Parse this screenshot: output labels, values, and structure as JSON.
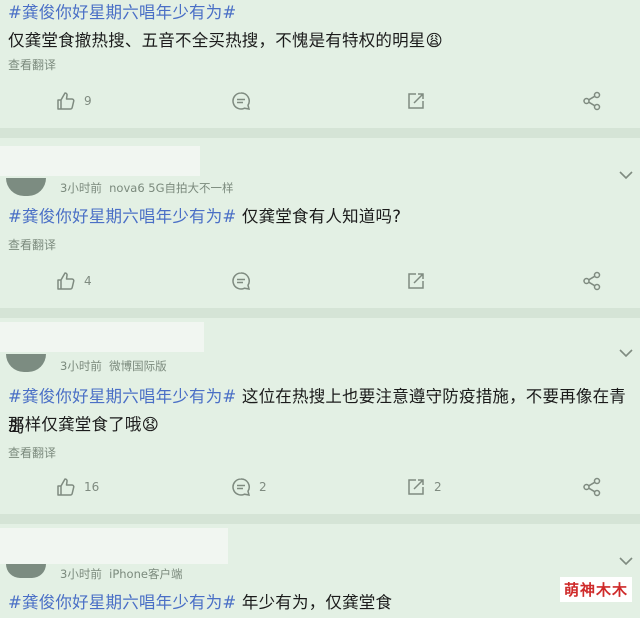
{
  "posts": [
    {
      "hashtag": "#龚俊你好星期六唱年少有为#",
      "text": "仅龚堂食撤热搜、五音不全买热搜，不愧是有特权的明星😩",
      "translate": "查看翻译",
      "likes": "9",
      "comments": "",
      "reposts": ""
    },
    {
      "time": "3小时前",
      "source": "nova6 5G自拍大不一样",
      "hashtag": "#龚俊你好星期六唱年少有为#",
      "text": " 仅龚堂食有人知道吗?",
      "translate": "查看翻译",
      "likes": "4",
      "comments": "",
      "reposts": ""
    },
    {
      "time": "3小时前",
      "source": "微博国际版",
      "hashtag": "#龚俊你好星期六唱年少有为#",
      "text": " 这位在热搜上也要注意遵守防疫措施，不要再像在青岛",
      "text2": "那样仅龚堂食了哦😧",
      "translate": "查看翻译",
      "likes": "16",
      "comments": "2",
      "reposts": "2"
    },
    {
      "time": "3小时前",
      "source": "iPhone客户端",
      "hashtag": "#龚俊你好星期六唱年少有为#",
      "text": " 年少有为，仅龚堂食"
    }
  ],
  "watermark": "萌神木木",
  "colors": {
    "hashtag": "#4a6fc6",
    "background": "#e3f0e4",
    "watermark": "#cf2a2a"
  }
}
